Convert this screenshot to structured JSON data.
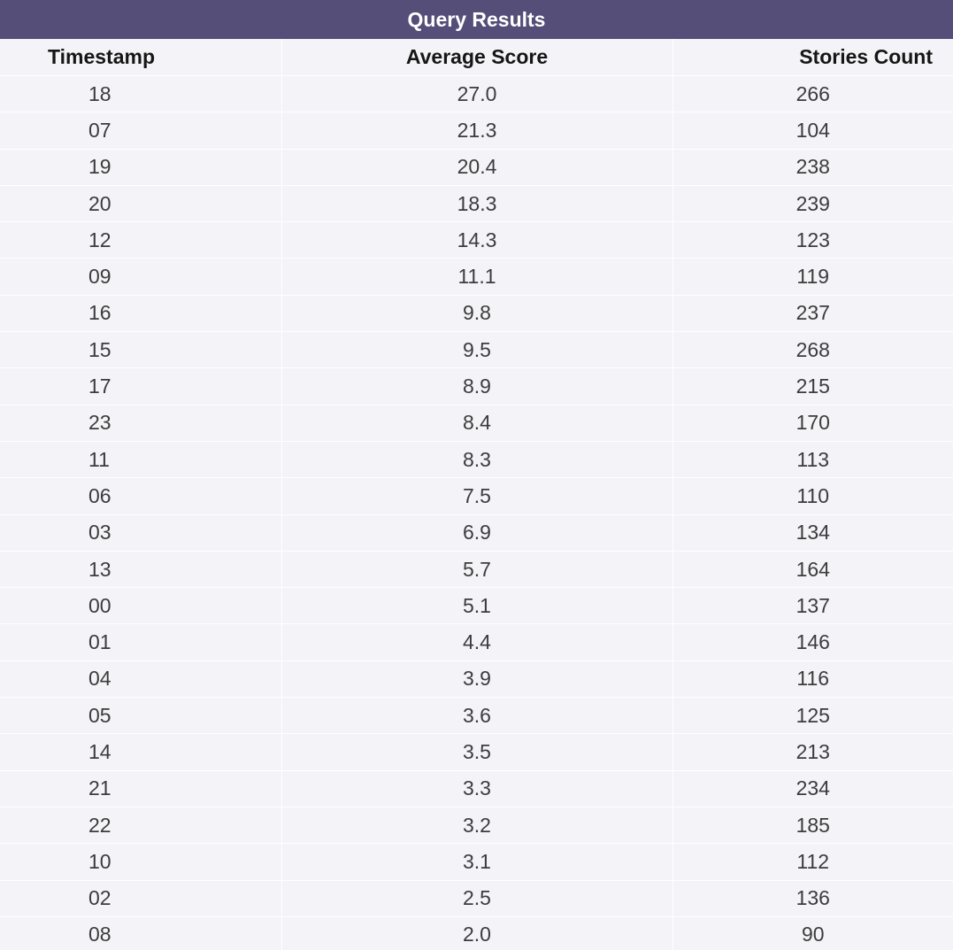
{
  "title": "Query Results",
  "columns": [
    "Timestamp",
    "Average Score",
    "Stories Count"
  ],
  "colors": {
    "header_bg": "#544e79",
    "body_bg": "#f4f3f8",
    "text": "#3c3c3c"
  },
  "chart_data": {
    "type": "table",
    "title": "Query Results",
    "columns": [
      "Timestamp",
      "Average Score",
      "Stories Count"
    ],
    "rows": [
      [
        "18",
        "27.0",
        "266"
      ],
      [
        "07",
        "21.3",
        "104"
      ],
      [
        "19",
        "20.4",
        "238"
      ],
      [
        "20",
        "18.3",
        "239"
      ],
      [
        "12",
        "14.3",
        "123"
      ],
      [
        "09",
        "11.1",
        "119"
      ],
      [
        "16",
        "9.8",
        "237"
      ],
      [
        "15",
        "9.5",
        "268"
      ],
      [
        "17",
        "8.9",
        "215"
      ],
      [
        "23",
        "8.4",
        "170"
      ],
      [
        "11",
        "8.3",
        "113"
      ],
      [
        "06",
        "7.5",
        "110"
      ],
      [
        "03",
        "6.9",
        "134"
      ],
      [
        "13",
        "5.7",
        "164"
      ],
      [
        "00",
        "5.1",
        "137"
      ],
      [
        "01",
        "4.4",
        "146"
      ],
      [
        "04",
        "3.9",
        "116"
      ],
      [
        "05",
        "3.6",
        "125"
      ],
      [
        "14",
        "3.5",
        "213"
      ],
      [
        "21",
        "3.3",
        "234"
      ],
      [
        "22",
        "3.2",
        "185"
      ],
      [
        "10",
        "3.1",
        "112"
      ],
      [
        "02",
        "2.5",
        "136"
      ],
      [
        "08",
        "2.0",
        "90"
      ]
    ]
  }
}
